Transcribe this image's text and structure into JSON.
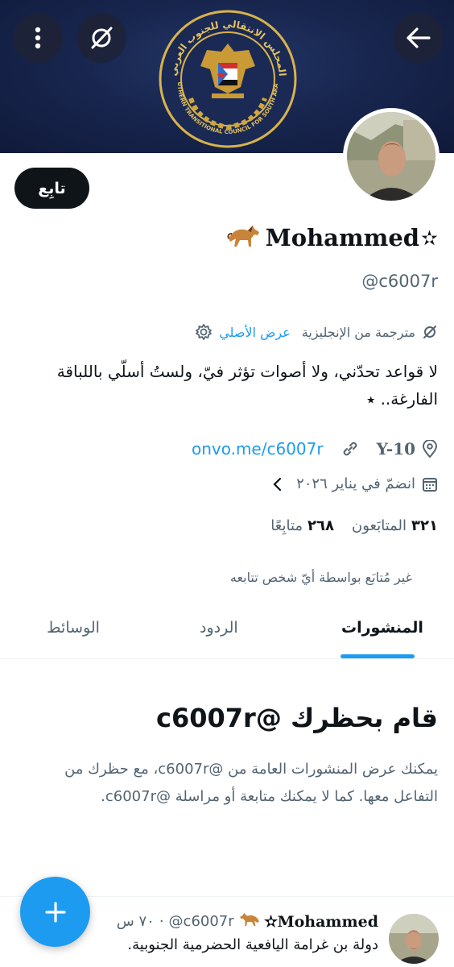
{
  "colors": {
    "accent": "#1d9bf0",
    "banner": "#16244d",
    "text": "#0f1419",
    "muted": "#536471"
  },
  "banner": {
    "emblem_ar": "المجلس الانتقالي للجنوب العربي",
    "emblem_en": "SOUTHERN TRANSITIONAL COUNCIL FOR SOUTH ARABIA"
  },
  "icons": {
    "more": "more-vertical-icon",
    "translate": "translate-off-icon",
    "back": "back-arrow-icon"
  },
  "profile": {
    "follow_label": "تابِع",
    "name": "Mohammed",
    "name_star": "✫",
    "handle": "@c6007r",
    "translated_label": "مترجمة من الإنجليزية",
    "show_original": "عرض الأصلي",
    "bio": "لا قواعد تحدّني، ولا أصوات تؤثر فيّ، ولستُ أسلّي باللباقة الفارغة.. ⭑",
    "location": "Y-10",
    "link": "onvo.me/c6007r",
    "joined": "انضمّ في يناير ٢٠٢٦",
    "followers_count": "٣٢١",
    "followers_label": "المتابَعون",
    "following_count": "٢٦٨",
    "following_label": "متابِعًا",
    "not_followed": "غير مُتابَع بواسطة أيّ شخص تتابعه"
  },
  "tabs": [
    {
      "label": "المنشورات",
      "active": true
    },
    {
      "label": "الردود",
      "active": false
    },
    {
      "label": "الوسائط",
      "active": false
    }
  ],
  "blocked": {
    "title": "قام بحظرك @c6007r",
    "description": "يمكنك عرض المنشورات العامة من @c6007r، مع حظرك من التفاعل معها. كما لا يمكنك متابعة أو مراسلة @c6007r."
  },
  "post": {
    "name": "Mohammed",
    "name_star": "✫",
    "handle": "@c6007r",
    "time": "٧٠ س",
    "text": "دولة بن غرامة اليافعية الحضرمية الجنوبية."
  },
  "fab": {
    "icon": "plus-icon"
  }
}
